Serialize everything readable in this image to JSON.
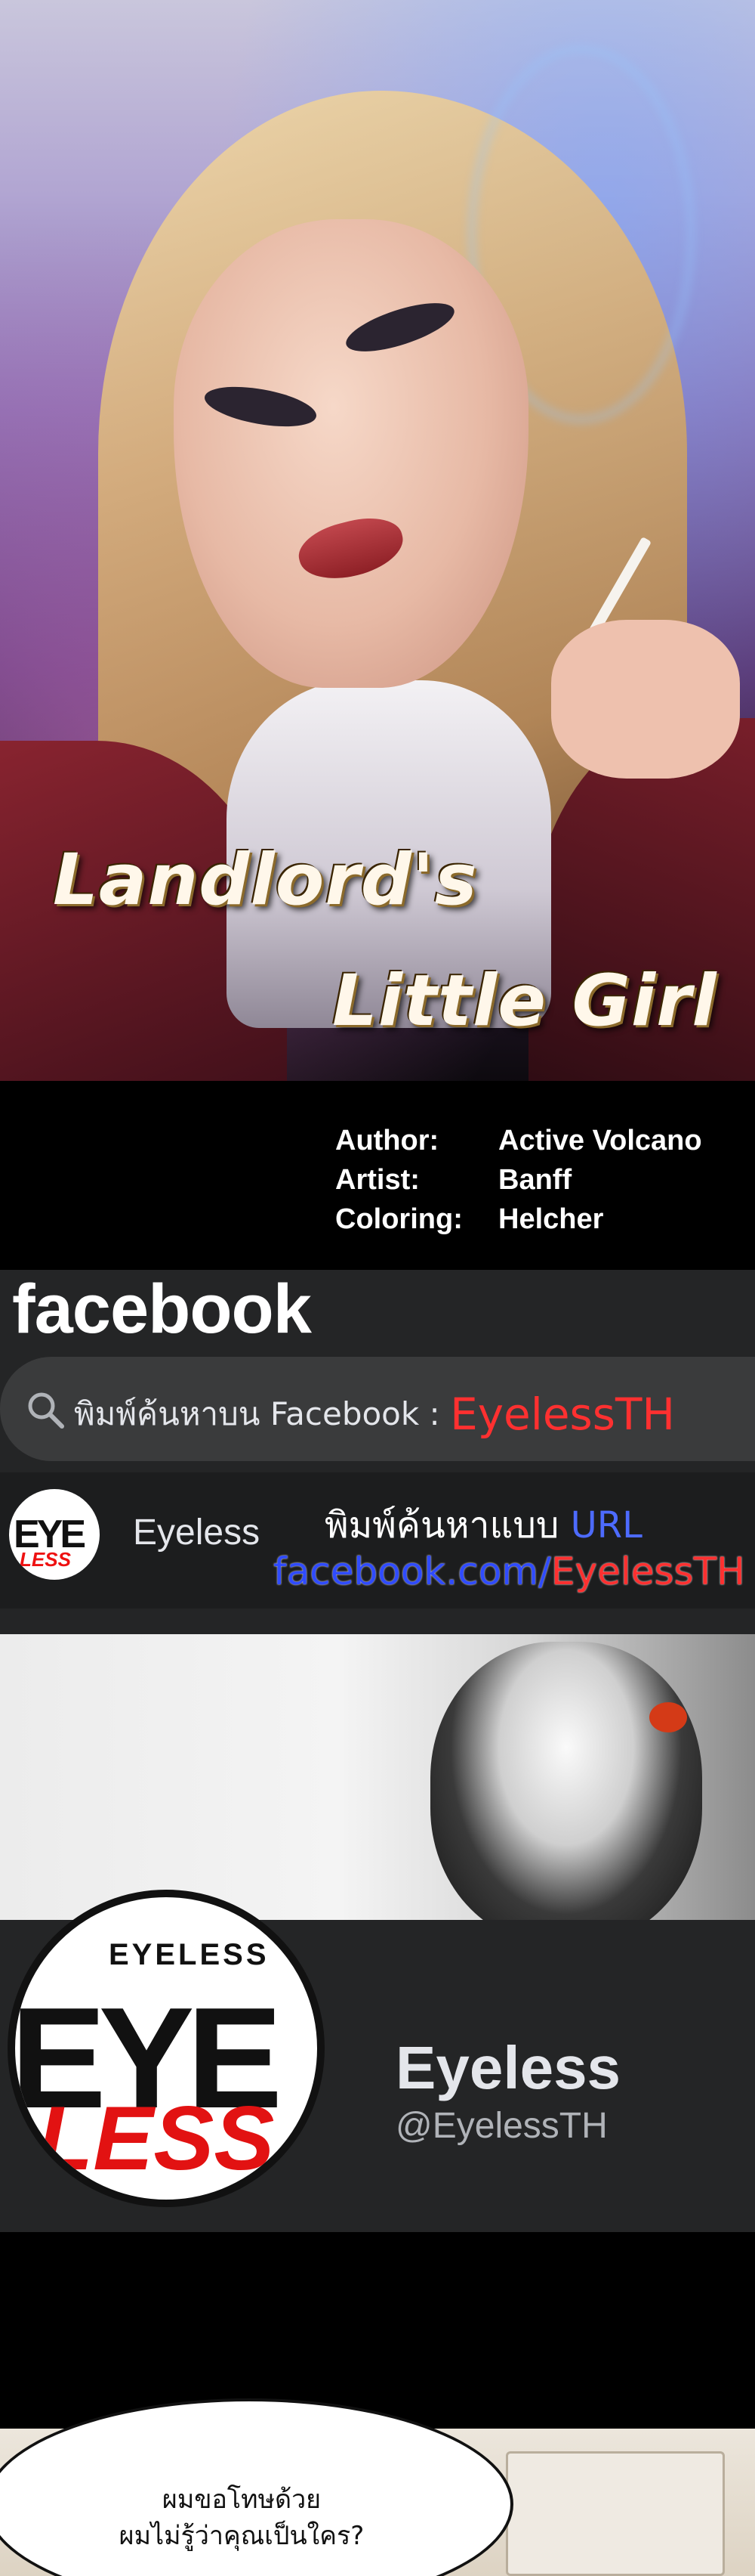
{
  "cover": {
    "title_line1": "Landlord's",
    "title_line2": "Little Girl"
  },
  "credits": [
    {
      "label": "Author:",
      "value": "Active Volcano"
    },
    {
      "label": "Artist:",
      "value": "Banff"
    },
    {
      "label": "Coloring:",
      "value": "Helcher"
    }
  ],
  "facebook": {
    "logo": "facebook",
    "search_prefix": "พิมพ์ค้นหาบน Facebook : ",
    "search_highlight": "EyelessTH",
    "page_name": "Eyeless",
    "hint_line1_text": "พิมพ์ค้นหาแบบ ",
    "hint_line1_url": "URL",
    "hint_line2_domain": "facebook.com/",
    "hint_line2_handle": "EyelessTH",
    "mini_avatar_top": "EYE",
    "mini_avatar_bottom": "LESS",
    "profile_avatar_small": "EYELESS",
    "profile_avatar_big": "EYE",
    "profile_avatar_less": "LESS",
    "profile_name": "Eyeless",
    "profile_handle": "@EyelessTH",
    "icons": [
      "search-icon"
    ]
  },
  "panel2": {
    "speech_line1": "ผมขอโทษด้วย",
    "speech_line2": "ผมไม่รู้ว่าคุณเป็นใคร?"
  }
}
